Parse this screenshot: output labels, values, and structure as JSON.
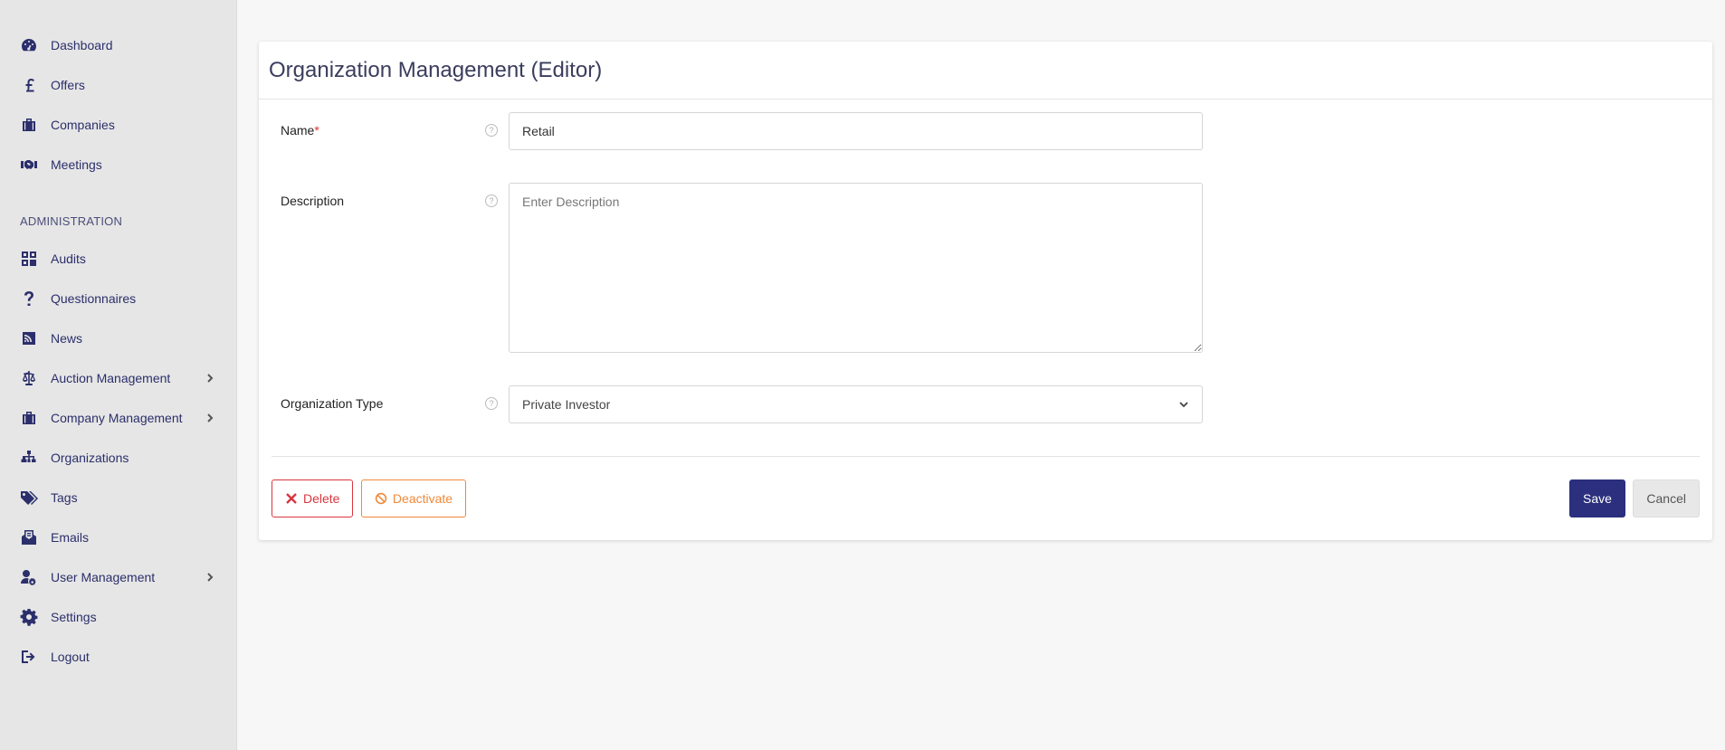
{
  "sidebar": {
    "items": [
      {
        "label": "Dashboard",
        "icon": "dashboard-icon"
      },
      {
        "label": "Offers",
        "icon": "pound-icon"
      },
      {
        "label": "Companies",
        "icon": "briefcase-icon"
      },
      {
        "label": "Meetings",
        "icon": "handshake-icon"
      }
    ],
    "section_title": "ADMINISTRATION",
    "admin_items": [
      {
        "label": "Audits",
        "icon": "grid-icon"
      },
      {
        "label": "Questionnaires",
        "icon": "question-icon"
      },
      {
        "label": "News",
        "icon": "rss-icon"
      },
      {
        "label": "Auction Management",
        "icon": "scale-icon",
        "has_children": true
      },
      {
        "label": "Company Management",
        "icon": "briefcase-icon",
        "has_children": true
      },
      {
        "label": "Organizations",
        "icon": "sitemap-icon"
      },
      {
        "label": "Tags",
        "icon": "tags-icon"
      },
      {
        "label": "Emails",
        "icon": "mail-icon"
      },
      {
        "label": "User Management",
        "icon": "user-cog-icon",
        "has_children": true
      },
      {
        "label": "Settings",
        "icon": "gear-icon"
      },
      {
        "label": "Logout",
        "icon": "logout-icon"
      }
    ]
  },
  "page": {
    "title": "Organization Management (Editor)"
  },
  "form": {
    "name": {
      "label": "Name",
      "required_mark": "*",
      "value": "Retail"
    },
    "description": {
      "label": "Description",
      "placeholder": "Enter Description",
      "value": ""
    },
    "organization_type": {
      "label": "Organization Type",
      "value": "Private Investor"
    },
    "help_glyph": "?"
  },
  "actions": {
    "delete_label": "Delete",
    "deactivate_label": "Deactivate",
    "save_label": "Save",
    "cancel_label": "Cancel"
  },
  "colors": {
    "primary": "#2b2f7d",
    "danger": "#d9363e",
    "warning": "#f0883a"
  }
}
